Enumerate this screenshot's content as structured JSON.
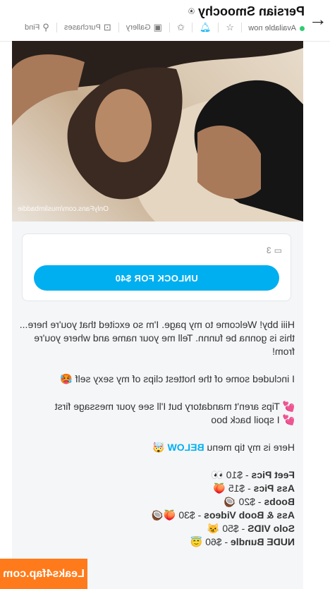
{
  "header": {
    "title": "Persian Smoochy",
    "verified_icon": "verified-badge-icon",
    "status": "Available now",
    "status_color": "#2ecc71",
    "toolbar": {
      "gallery": "Gallery",
      "purchases": "Purchases",
      "find": "Find"
    }
  },
  "post": {
    "watermark": "OnlyFans.com/muslimbaddie",
    "media_count": "3",
    "unlock_label": "UNLOCK FOR $40",
    "lines": {
      "p1": "Hiii bby! Welcome to my page. I'm so excited that you're here... this is gonna be funnn. Tell me your name and where you're from!",
      "p2": "I included some of the hottest clips of my sexy self 🥵",
      "p3a": "💕 Tips aren't mandatory but I'll see your message first",
      "p3b": "💕 I spoil back boo",
      "p4_pre": "Here is my tip menu ",
      "p4_blue": "BELOW",
      "p4_post": " 🤯",
      "menu1_b": "Feet Pics",
      "menu1_r": "- $10 👀",
      "menu2_b": "Ass Pics",
      "menu2_r": "- $15 🍑",
      "menu3_b": "Boobs",
      "menu3_r": "- $20 🥥",
      "menu4_b": "Ass & Boob Videos",
      "menu4_r": "- $30 🍑🥥",
      "menu5_b": "Solo VIDS",
      "menu5_r": "- $50 😼",
      "menu6_b": "NUDE Bundle",
      "menu6_r": "- $60 😇"
    }
  },
  "overlay": {
    "site_badge": "Leaks4fap.com"
  },
  "colors": {
    "accent": "#00aff0",
    "badge": "#ff7a1a"
  }
}
